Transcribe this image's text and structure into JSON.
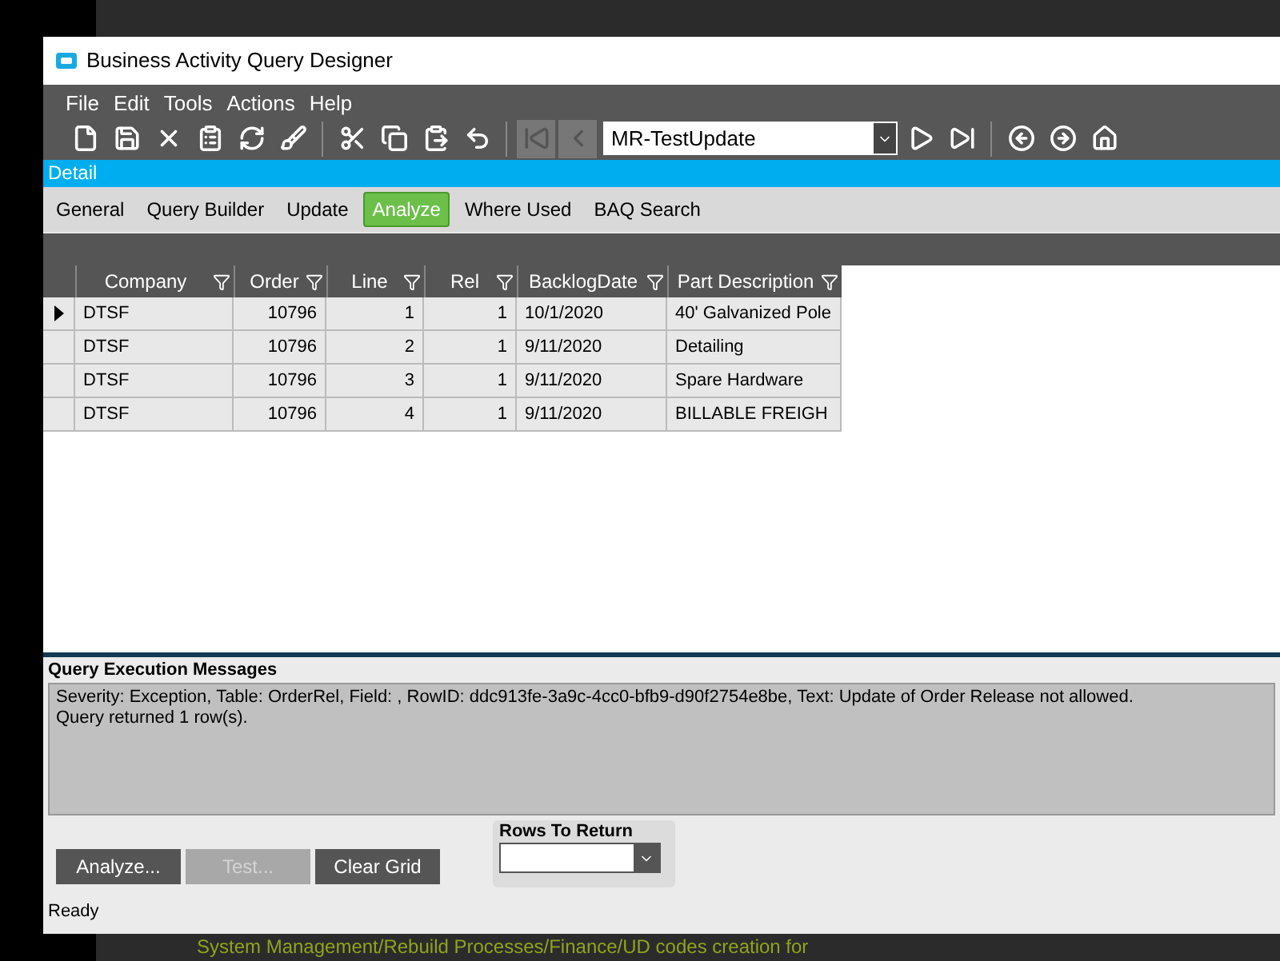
{
  "window": {
    "title": "Business Activity Query Designer"
  },
  "menu": [
    "File",
    "Edit",
    "Tools",
    "Actions",
    "Help"
  ],
  "toolbar": {
    "record": "MR-TestUpdate"
  },
  "panel_title": "Detail",
  "tabs": [
    {
      "label": "General",
      "selected": false
    },
    {
      "label": "Query Builder",
      "selected": false
    },
    {
      "label": "Update",
      "selected": false
    },
    {
      "label": "Analyze",
      "selected": true
    },
    {
      "label": "Where Used",
      "selected": false
    },
    {
      "label": "BAQ Search",
      "selected": false
    }
  ],
  "table": {
    "columns": [
      {
        "label": "Company",
        "numeric": false
      },
      {
        "label": "Order",
        "numeric": true
      },
      {
        "label": "Line",
        "numeric": true
      },
      {
        "label": "Rel",
        "numeric": true
      },
      {
        "label": "BacklogDate",
        "numeric": false
      },
      {
        "label": "Part Description",
        "numeric": false
      }
    ],
    "rows": [
      {
        "selected": true,
        "cells": [
          "DTSF",
          "10796",
          "1",
          "1",
          "10/1/2020",
          "40' Galvanized Pole"
        ]
      },
      {
        "selected": false,
        "cells": [
          "DTSF",
          "10796",
          "2",
          "1",
          "9/11/2020",
          "Detailing"
        ]
      },
      {
        "selected": false,
        "cells": [
          "DTSF",
          "10796",
          "3",
          "1",
          "9/11/2020",
          "Spare Hardware"
        ]
      },
      {
        "selected": false,
        "cells": [
          "DTSF",
          "10796",
          "4",
          "1",
          "9/11/2020",
          "BILLABLE FREIGH"
        ]
      }
    ]
  },
  "messages": {
    "title": "Query Execution Messages",
    "lines": [
      "Severity: Exception, Table: OrderRel, Field: , RowID: ddc913fe-3a9c-4cc0-bfb9-d90f2754e8be, Text: Update of Order Release not allowed.",
      "Query returned 1 row(s)."
    ]
  },
  "buttons": [
    {
      "label": "Analyze...",
      "disabled": false
    },
    {
      "label": "Test...",
      "disabled": true
    },
    {
      "label": "Clear Grid",
      "disabled": false
    }
  ],
  "rows_to_return": {
    "label": "Rows To Return"
  },
  "status_bar": "Ready",
  "background_text": [
    "System Management/Rebuild Processes/Finance/UD codes creation for"
  ]
}
